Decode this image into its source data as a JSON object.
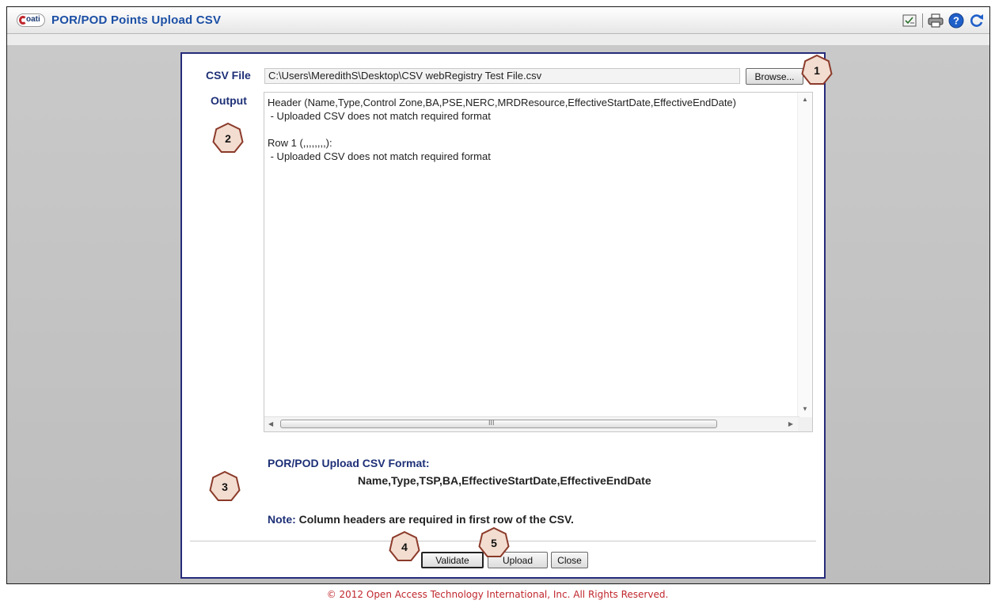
{
  "window": {
    "logo_text": "oati",
    "title": "POR/POD Points Upload CSV"
  },
  "toolbar": {
    "icons": [
      "checklist-icon",
      "printer-icon",
      "help-icon",
      "refresh-icon"
    ]
  },
  "form": {
    "csv_file_label": "CSV File",
    "csv_file_value": "C:\\Users\\MeredithS\\Desktop\\CSV webRegistry Test File.csv",
    "browse_label": "Browse...",
    "output_label": "Output",
    "output_text": "Header (Name,Type,Control Zone,BA,PSE,NERC,MRDResource,EffectiveStartDate,EffectiveEndDate)\n - Uploaded CSV does not match required format\n\nRow 1 (,,,,,,,,):\n - Uploaded CSV does not match required format",
    "scroll_grip": "III"
  },
  "format_info": {
    "title": "POR/POD Upload CSV Format:",
    "columns": "Name,Type,TSP,BA,EffectiveStartDate,EffectiveEndDate",
    "note_label": "Note:",
    "note_text": " Column headers are required in first row of the CSV."
  },
  "buttons": {
    "validate": "Validate",
    "upload": "Upload",
    "close": "Close"
  },
  "callouts": [
    "1",
    "2",
    "3",
    "4",
    "5"
  ],
  "footer": "© 2012 Open Access Technology International, Inc. All Rights Reserved.",
  "colors": {
    "title_blue": "#1b4fa5",
    "label_navy": "#1e3077",
    "callout_fill": "#f3ddd0",
    "callout_stroke": "#8b3a2a",
    "footer_red": "#c0272d"
  }
}
